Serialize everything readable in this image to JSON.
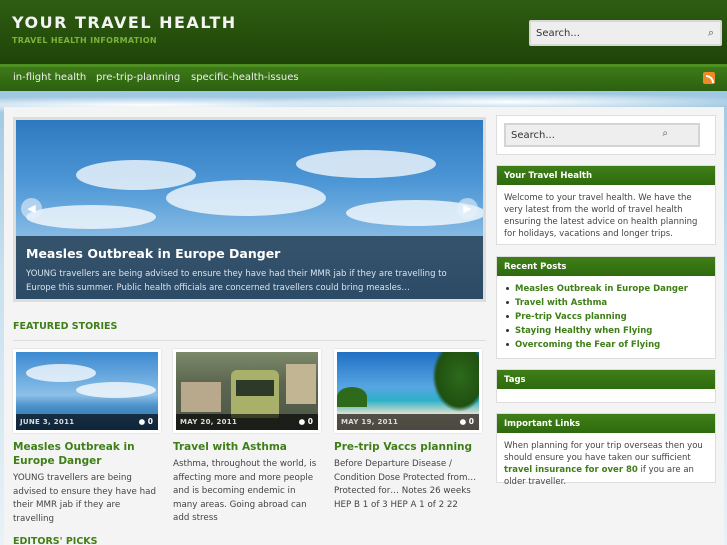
{
  "header": {
    "site_title": "YOUR TRAVEL HEALTH",
    "site_description": "TRAVEL HEALTH INFORMATION",
    "search_placeholder": "Search..."
  },
  "nav": {
    "items": [
      "in-flight health",
      "pre-trip-planning",
      "specific-health-issues"
    ],
    "rss_icon": "rss-icon"
  },
  "slider": {
    "title": "Measles Outbreak in Europe Danger",
    "excerpt": "YOUNG travellers are being advised to ensure they have had their MMR jab if they are travelling to Europe this summer. Public health officials are concerned travellers could bring measles…",
    "prev_icon": "prev-arrow-icon",
    "next_icon": "next-arrow-icon"
  },
  "featured": {
    "title": "FEATURED STORIES",
    "cards": [
      {
        "date": "JUNE 3, 2011",
        "comments": "0",
        "title": "Measles Outbreak in Europe Danger",
        "excerpt": "YOUNG travellers are being advised to ensure they have had their MMR jab if they are travelling"
      },
      {
        "date": "MAY 20, 2011",
        "comments": "0",
        "title": "Travel with Asthma",
        "excerpt": "Asthma, throughout the world, is affecting more and more people and is becoming endemic in many areas. Going abroad can add stress"
      },
      {
        "date": "MAY 19, 2011",
        "comments": "0",
        "title": "Pre-trip Vaccs planning",
        "excerpt": "Before Departure Disease / Condition Dose Protected from… Protected for… Notes 26 weeks HEP B 1 of 3 HEP A 1 of 2 22"
      }
    ]
  },
  "editors_picks": {
    "title": "EDITORS' PICKS"
  },
  "sidebar": {
    "search_placeholder": "Search...",
    "about": {
      "title": "Your Travel Health",
      "text": "Welcome to your travel health. We have the very latest from the world of travel health ensuring the latest advice on health planning for holidays, vacations and longer trips."
    },
    "recent": {
      "title": "Recent Posts",
      "items": [
        "Measles Outbreak in Europe Danger",
        "Travel with Asthma",
        "Pre-trip Vaccs planning",
        "Staying Healthy when Flying",
        "Overcoming the Fear of Flying"
      ]
    },
    "tags": {
      "title": "Tags"
    },
    "links": {
      "title": "Important Links",
      "text_before": "When planning for your trip overseas then you should ensure you have taken our sufficient ",
      "link": "travel insurance for over 80",
      "text_after": " if you are an older traveller."
    }
  },
  "colors": {
    "brand_green": "#3f7f17",
    "header_dark": "#1f4408",
    "accent_light": "#7bb33a"
  }
}
